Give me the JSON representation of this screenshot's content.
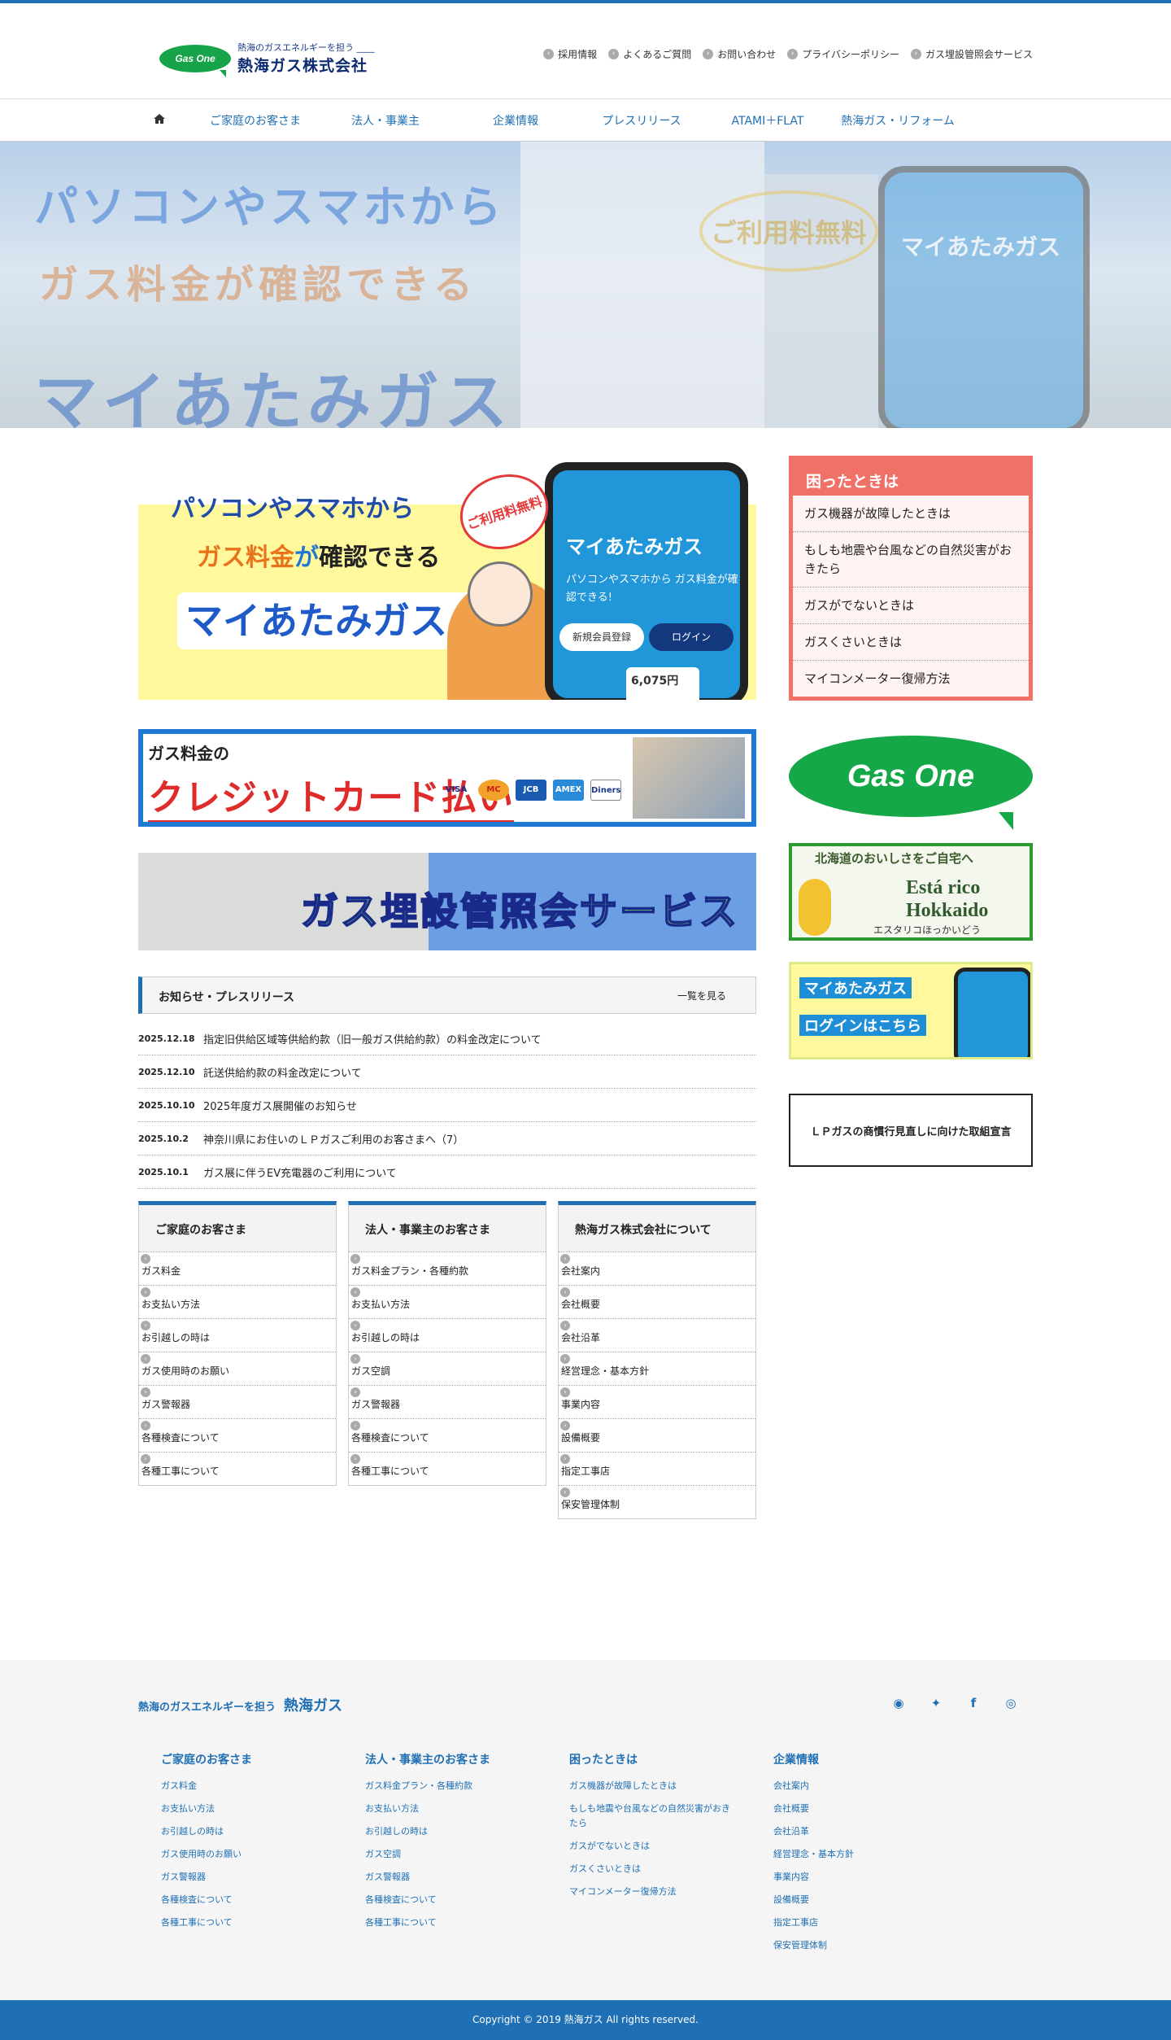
{
  "header": {
    "logo_badge": "Gas One",
    "tagline": "熱海のガスエネルギーを担う ____",
    "company_name": "熱海ガス株式会社",
    "util_nav": [
      "採用情報",
      "よくあるご質問",
      "お問い合わせ",
      "プライバシーポリシー",
      "ガス埋設管照会サービス"
    ]
  },
  "gnav": [
    "ご家庭のお客さま",
    "法人・事業主",
    "企業情報",
    "プレスリリース",
    "ATAMI＋FLAT",
    "熱海ガス・リフォーム"
  ],
  "hero": {
    "line1": "パソコンやスマホから",
    "line2": "ガス料金が確認できる",
    "line3": "マイあたみガス",
    "badge": "ご利用料無料",
    "phone_title": "マイあたみガス"
  },
  "banner1": {
    "line1": "パソコンやスマホから",
    "line2_a": "ガス料金",
    "line2_b": "が",
    "line2_c": "確認できる",
    "line3": "マイあたみガス",
    "stamp": "ご利用料無料",
    "phone_title": "マイあたみガス",
    "phone_sub": "パソコンやスマホから ガス料金が確認できる!",
    "btn_register": "新規会員登録",
    "btn_login": "ログイン",
    "amount": "6,075円"
  },
  "banner2": {
    "line1": "ガス料金の",
    "line2": "クレジットカード払い",
    "cards": [
      "VISA",
      "MC",
      "JCB",
      "AMEX",
      "Diners"
    ]
  },
  "banner3": {
    "text": "ガス埋設管照会サービス"
  },
  "news": {
    "title": "お知らせ・プレスリリース",
    "more": "一覧を見る",
    "items": [
      {
        "date": "2025.12.18",
        "text": "指定旧供給区域等供給約款（旧一般ガス供給約款）の料金改定について"
      },
      {
        "date": "2025.12.10",
        "text": "託送供給約款の料金改定について"
      },
      {
        "date": "2025.10.10",
        "text": "2025年度ガス展開催のお知らせ"
      },
      {
        "date": "2025.10.2",
        "text": "神奈川県にお住いのＬＰガスご利用のお客さまへ（7）"
      },
      {
        "date": "2025.10.1",
        "text": "ガス展に伴うEV充電器のご利用について"
      }
    ]
  },
  "categories": [
    {
      "title": "ご家庭のお客さま",
      "items": [
        "ガス料金",
        "お支払い方法",
        "お引越しの時は",
        "ガス使用時のお願い",
        "ガス警報器",
        "各種検査について",
        "各種工事について"
      ]
    },
    {
      "title": "法人・事業主のお客さま",
      "items": [
        "ガス料金プラン・各種約款",
        "お支払い方法",
        "お引越しの時は",
        "ガス空調",
        "ガス警報器",
        "各種検査について",
        "各種工事について"
      ]
    },
    {
      "title": "熱海ガス株式会社について",
      "items": [
        "会社案内",
        "会社概要",
        "会社沿革",
        "経営理念・基本方針",
        "事業内容",
        "設備概要",
        "指定工事店",
        "保安管理体制"
      ]
    }
  ],
  "trouble": {
    "title": "困ったときは",
    "items": [
      "ガス機器が故障したときは",
      "もしも地震や台風などの自然災害がおきたら",
      "ガスがでないときは",
      "ガスくさいときは",
      "マイコンメーター復帰方法"
    ]
  },
  "side": {
    "gasone": "Gas One",
    "hokkaido_line1": "北海道のおいしさをご自宅へ",
    "hokkaido_line2": "Está rico",
    "hokkaido_line3": "Hokkaido",
    "hokkaido_line4": "エスタリコほっかいどう",
    "login_line1": "マイあたみガス",
    "login_line2": "ログインはこちら",
    "lp_box": "ＬＰガスの商慣行見直しに向けた取組宣言"
  },
  "footer": {
    "tagline": "熱海のガスエネルギーを担う",
    "brand": "熱海ガス",
    "columns": [
      {
        "title": "ご家庭のお客さま",
        "items": [
          "ガス料金",
          "お支払い方法",
          "お引越しの時は",
          "ガス使用時のお願い",
          "ガス警報器",
          "各種検査について",
          "各種工事について"
        ]
      },
      {
        "title": "法人・事業主のお客さま",
        "items": [
          "ガス料金プラン・各種約款",
          "お支払い方法",
          "お引越しの時は",
          "ガス空調",
          "ガス警報器",
          "各種検査について",
          "各種工事について"
        ]
      },
      {
        "title": "困ったときは",
        "items": [
          "ガス機器が故障したときは",
          "もしも地震や台風などの自然災害がおきたら",
          "ガスがでないときは",
          "ガスくさいときは",
          "マイコンメーター復帰方法"
        ]
      },
      {
        "title": "企業情報",
        "items": [
          "会社案内",
          "会社概要",
          "会社沿革",
          "経営理念・基本方針",
          "事業内容",
          "設備概要",
          "指定工事店",
          "保安管理体制"
        ]
      }
    ],
    "copyright": "Copyright ©  2019 熱海ガス All rights reserved."
  },
  "colors": {
    "brand_blue": "#1f6fb4",
    "gasone_green": "#17a34a",
    "trouble_red": "#f07167"
  }
}
